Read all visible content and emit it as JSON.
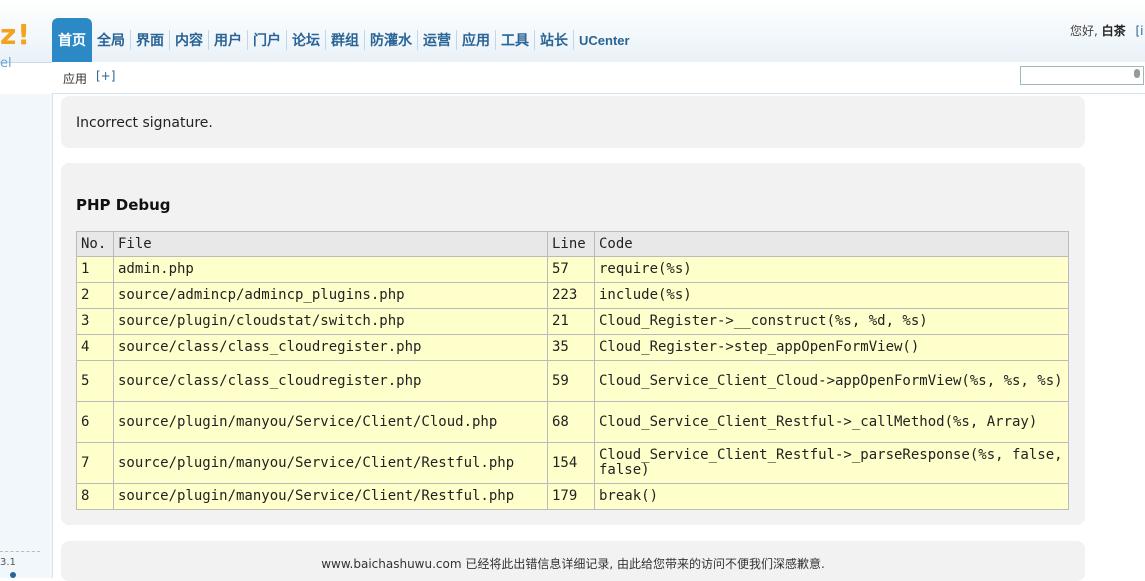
{
  "header": {
    "logo_text": "z!",
    "logo_sub": "el",
    "nav": [
      {
        "label": "首页",
        "active": true
      },
      {
        "label": "全局"
      },
      {
        "label": "界面"
      },
      {
        "label": "内容"
      },
      {
        "label": "用户"
      },
      {
        "label": "门户"
      },
      {
        "label": "论坛"
      },
      {
        "label": "群组"
      },
      {
        "label": "防灌水"
      },
      {
        "label": "运营"
      },
      {
        "label": "应用"
      },
      {
        "label": "工具"
      },
      {
        "label": "站长"
      },
      {
        "label": "UCenter"
      }
    ],
    "greeting_prefix": "您好,",
    "username": "白茶",
    "greeting_tail": "[i"
  },
  "subnav": {
    "label": "应用",
    "add": "[+]"
  },
  "sidebar": {
    "version": "3.1"
  },
  "error": {
    "message": "Incorrect signature."
  },
  "debug": {
    "title": "PHP Debug",
    "columns": [
      "No.",
      "File",
      "Line",
      "Code"
    ],
    "rows": [
      {
        "no": "1",
        "file": "admin.php",
        "line": "57",
        "code": "require(%s)"
      },
      {
        "no": "2",
        "file": "source/admincp/admincp_plugins.php",
        "line": "223",
        "code": "include(%s)"
      },
      {
        "no": "3",
        "file": "source/plugin/cloudstat/switch.php",
        "line": "21",
        "code": "Cloud_Register->__construct(%s, %d, %s)"
      },
      {
        "no": "4",
        "file": "source/class/class_cloudregister.php",
        "line": "35",
        "code": "Cloud_Register->step_appOpenFormView()"
      },
      {
        "no": "5",
        "file": "source/class/class_cloudregister.php",
        "line": "59",
        "code": "Cloud_Service_Client_Cloud->appOpenFormView(%s, %s, %s)"
      },
      {
        "no": "6",
        "file": "source/plugin/manyou/Service/Client/Cloud.php",
        "line": "68",
        "code": "Cloud_Service_Client_Restful->_callMethod(%s, Array)"
      },
      {
        "no": "7",
        "file": "source/plugin/manyou/Service/Client/Restful.php",
        "line": "154",
        "code": "Cloud_Service_Client_Restful->_parseResponse(%s, false, false)"
      },
      {
        "no": "8",
        "file": "source/plugin/manyou/Service/Client/Restful.php",
        "line": "179",
        "code": "break()"
      }
    ]
  },
  "footer": {
    "text": "www.baichashuwu.com 已经将此出错信息详细记录, 由此给您带来的访问不便我们深感歉意."
  },
  "colors": {
    "nav_active": "#2b8ac6",
    "nav_text": "#2a6496",
    "row_bg": "#ffffcc",
    "box_bg": "#f2f2f2"
  }
}
